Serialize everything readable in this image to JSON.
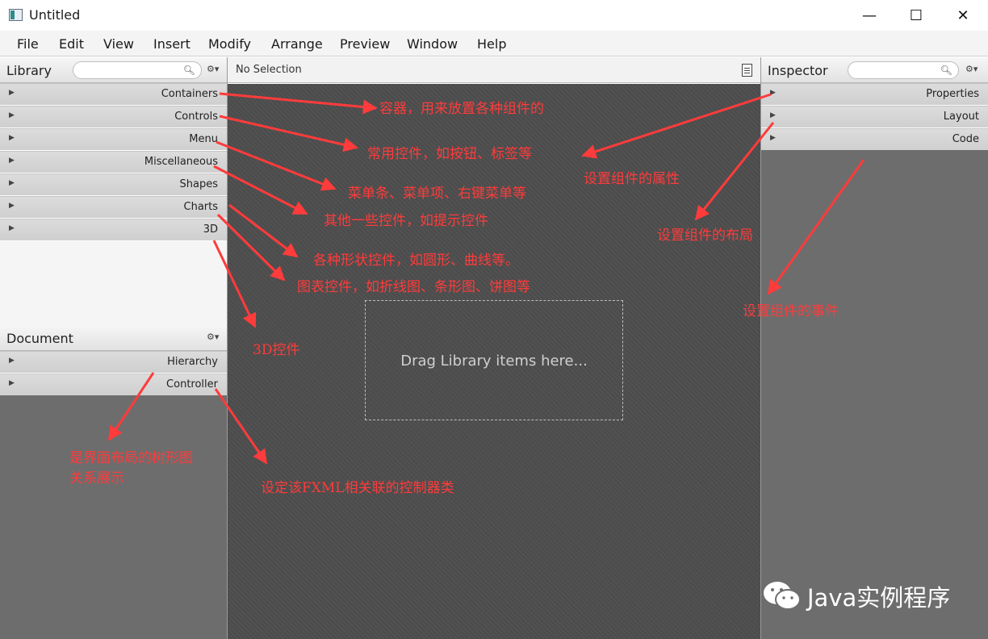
{
  "window": {
    "title": "Untitled",
    "controls": {
      "minimize": "—",
      "maximize": "☐",
      "close": "✕"
    }
  },
  "menubar": [
    {
      "label": "File"
    },
    {
      "label": "Edit"
    },
    {
      "label": "View"
    },
    {
      "label": "Insert"
    },
    {
      "label": "Modify"
    },
    {
      "label": "Arrange"
    },
    {
      "label": "Preview"
    },
    {
      "label": "Window"
    },
    {
      "label": "Help"
    }
  ],
  "library": {
    "title": "Library",
    "search_value": "",
    "sections": [
      "Containers",
      "Controls",
      "Menu",
      "Miscellaneous",
      "Shapes",
      "Charts",
      "3D"
    ]
  },
  "document": {
    "title": "Document",
    "sections": [
      "Hierarchy",
      "Controller"
    ]
  },
  "canvas": {
    "selection": "No Selection",
    "drop_hint": "Drag Library items here..."
  },
  "inspector": {
    "title": "Inspector",
    "search_value": "",
    "sections": [
      "Properties",
      "Layout",
      "Code"
    ]
  },
  "annotations": [
    {
      "id": "containers",
      "text": "容器，用来放置各种组件的"
    },
    {
      "id": "controls",
      "text": "常用控件，如按钮、标签等"
    },
    {
      "id": "menu",
      "text": "菜单条、菜单项、右键菜单等"
    },
    {
      "id": "misc",
      "text": "其他一些控件，如提示控件"
    },
    {
      "id": "shapes",
      "text": "各种形状控件，如圆形、曲线等。"
    },
    {
      "id": "charts",
      "text": "图表控件，如折线图、条形图、饼图等"
    },
    {
      "id": "3d",
      "text": "3D控件"
    },
    {
      "id": "hierarchy-1",
      "text": "是界面布局的树形图"
    },
    {
      "id": "hierarchy-2",
      "text": "关系展示"
    },
    {
      "id": "controller",
      "text": "设定该FXML相关联的控制器类"
    },
    {
      "id": "properties",
      "text": "设置组件的属性"
    },
    {
      "id": "layout",
      "text": "设置组件的布局"
    },
    {
      "id": "code",
      "text": "设置组件的事件"
    }
  ],
  "watermark": {
    "text": "Java实例程序"
  },
  "colors": {
    "annotation": "#ff3b3b",
    "canvas": "#4b4b4b",
    "panel_dark": "#6d6d6d"
  }
}
